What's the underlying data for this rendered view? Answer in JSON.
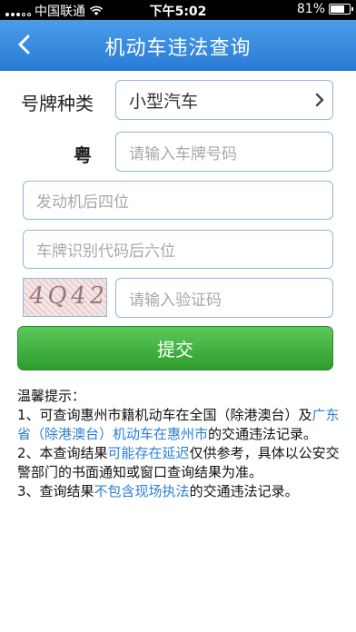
{
  "status": {
    "carrier": "中国联通",
    "time": "下午5:02",
    "battery": "81%",
    "battery_level": 0.81
  },
  "nav": {
    "title": "机动车违法查询",
    "back_icon": "chevron-left-icon"
  },
  "form": {
    "plate_type_label": "号牌种类",
    "plate_type_value": "小型汽车",
    "province_label": "粤",
    "plate_placeholder": "请输入车牌号码",
    "engine_placeholder": "发动机后四位",
    "vin_placeholder": "车牌识别代码后六位",
    "captcha_text": "4Q42",
    "captcha_placeholder": "请输入验证码",
    "submit_label": "提交"
  },
  "tips": {
    "heading": "温馨提示：",
    "t1_a": "1、可查询惠州市籍机动车在全国（除港澳台）及",
    "t1_hl": "广东省（除港澳台）机动车在惠州市",
    "t1_b": "的交通违法记录。",
    "t2_a": "2、本查询结果",
    "t2_hl": "可能存在延迟",
    "t2_b": "仅供参考，具体以公安交警部门的书面通知或窗口查询结果为准。",
    "t3_a": "3、查询结果",
    "t3_hl": "不包含现场执法",
    "t3_b": "的交通违法记录。"
  },
  "colors": {
    "nav": "#2a7bd6",
    "submit": "#3aab3a",
    "highlight": "#2a7fd6",
    "field_border": "#8fb6e0"
  }
}
